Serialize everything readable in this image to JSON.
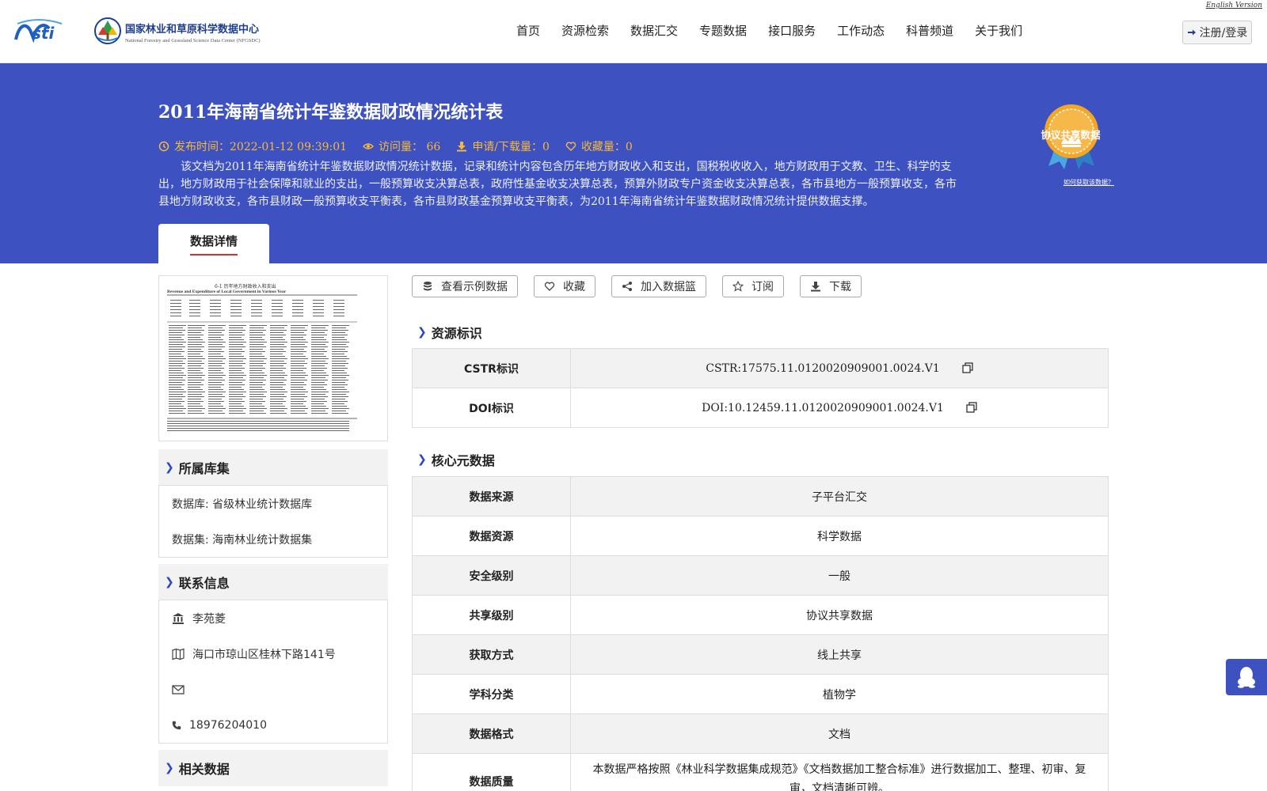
{
  "header": {
    "english_link": "English Version",
    "logo_title": "国家林业和草原科学数据中心",
    "logo_subtitle": "National Forestry and Grassland Science Data Center (NFGSDC)",
    "nav": [
      "首页",
      "资源检索",
      "数据汇交",
      "专题数据",
      "接口服务",
      "工作动态",
      "科普频道",
      "关于我们"
    ],
    "login_label": "注册/登录"
  },
  "hero": {
    "title": "2011年海南省统计年鉴数据财政情况统计表",
    "publish_time": "发布时间：2022-01-12 09:39:01",
    "visits": "访问量： 66",
    "downloads": "申请/下载量：0",
    "favorites": "收藏量：0",
    "description": "该文档为2011年海南省统计年鉴数据财政情况统计数据，记录和统计内容包含历年地方财政收入和支出，国税税收收入，地方财政用于文教、卫生、科学的支出，地方财政用于社会保障和就业的支出，一般预算收支决算总表，政府性基金收支决算总表，预算外财政专户资金收支决算总表，各市县地方一般预算收支，各市县地方财政收支，各市县财政一般预算收支平衡表，各市县财政基金预算收支平衡表，为2011年海南省统计年鉴数据财政情况统计提供数据支撑。",
    "badge_label": "协议共享数据",
    "badge_link": "如何获取该数据？",
    "tab_label": "数据详情",
    "colors": {
      "hero_bg": "#3d52c0",
      "meta": "#f6b83a",
      "accent_red": "#d9302c"
    }
  },
  "left": {
    "thumb_title": "6-1 历年地方财政收入和支出",
    "thumb_subtitle": "Revenue and Expenditure of Local Government in Various Year",
    "library_head": "所属库集",
    "database": "数据库: 省级林业统计数据库",
    "dataset": "数据集: 海南林业统计数据集",
    "contact_head": "联系信息",
    "contact_org": "李苑菱",
    "contact_address": "海口市琼山区桂林下路141号",
    "contact_email": "",
    "contact_phone": "18976204010",
    "related_head": "相关数据"
  },
  "actions": {
    "sample": "查看示例数据",
    "favorite": "收藏",
    "basket": "加入数据篮",
    "subscribe": "订阅",
    "download": "下载"
  },
  "identifiers": {
    "head": "资源标识",
    "rows": [
      {
        "k": "CSTR标识",
        "v": "CSTR:17575.11.0120020909001.0024.V1"
      },
      {
        "k": "DOI标识",
        "v": "DOI:10.12459.11.0120020909001.0024.V1"
      }
    ]
  },
  "core": {
    "head": "核心元数据",
    "rows": [
      {
        "k": "数据来源",
        "v": "子平台汇交"
      },
      {
        "k": "数据资源",
        "v": "科学数据"
      },
      {
        "k": "安全级别",
        "v": "一般"
      },
      {
        "k": "共享级别",
        "v": "协议共享数据"
      },
      {
        "k": "获取方式",
        "v": "线上共享"
      },
      {
        "k": "学科分类",
        "v": "植物学"
      },
      {
        "k": "数据格式",
        "v": "文档"
      },
      {
        "k": "数据质量",
        "v": "本数据严格按照《林业科学数据集成规范》《文档数据加工整合标准》进行数据加工、整理、初审、复审，文档清晰可辨。"
      }
    ]
  }
}
